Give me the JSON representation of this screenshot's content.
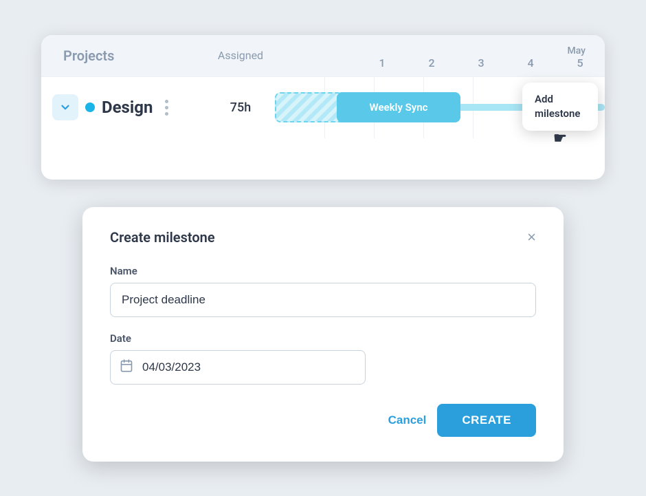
{
  "gantt": {
    "header": {
      "projects_label": "Projects",
      "assigned_label": "Assigned",
      "month_label": "May",
      "days": [
        "1",
        "2",
        "3",
        "4",
        "5"
      ]
    },
    "row": {
      "project_name": "Design",
      "hours": "75h",
      "bar_solid_label": "Weekly Sync",
      "tooltip_label": "Add\nmilestone"
    }
  },
  "modal": {
    "title": "Create milestone",
    "close_label": "×",
    "name_label": "Name",
    "name_value": "Project deadline",
    "date_label": "Date",
    "date_value": "04/03/2023",
    "cancel_label": "Cancel",
    "create_label": "CREATE"
  }
}
